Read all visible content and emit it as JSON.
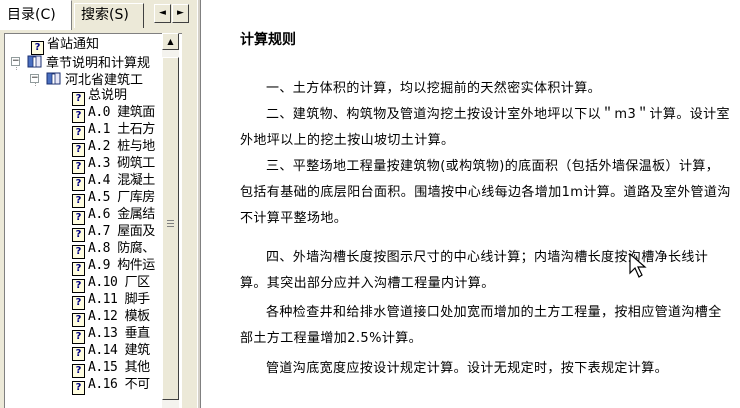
{
  "tabs": {
    "contents": "目录(C)",
    "search": "搜索(S)",
    "arrow_left": "◄",
    "arrow_right": "►"
  },
  "tree": {
    "items": [
      {
        "label": "省站通知",
        "icon": "help-page-icon"
      },
      {
        "label": "章节说明和计算规",
        "icon": "book-icon",
        "expander": "−"
      },
      {
        "label": "河北省建筑工",
        "icon": "book-icon",
        "expander": "−"
      },
      {
        "label": "总说明",
        "icon": "help-page-icon"
      },
      {
        "label": "A.0 建筑面",
        "icon": "help-page-icon"
      },
      {
        "label": "A.1 土石方",
        "icon": "help-page-icon"
      },
      {
        "label": "A.2 桩与地",
        "icon": "help-page-icon"
      },
      {
        "label": "A.3 砌筑工",
        "icon": "help-page-icon"
      },
      {
        "label": "A.4 混凝土",
        "icon": "help-page-icon"
      },
      {
        "label": "A.5 厂库房",
        "icon": "help-page-icon"
      },
      {
        "label": "A.6 金属结",
        "icon": "help-page-icon"
      },
      {
        "label": "A.7 屋面及",
        "icon": "help-page-icon"
      },
      {
        "label": "A.8 防腐、",
        "icon": "help-page-icon"
      },
      {
        "label": "A.9 构件运",
        "icon": "help-page-icon"
      },
      {
        "label": "A.10 厂区",
        "icon": "help-page-icon"
      },
      {
        "label": "A.11 脚手",
        "icon": "help-page-icon"
      },
      {
        "label": "A.12 模板",
        "icon": "help-page-icon"
      },
      {
        "label": "A.13 垂直",
        "icon": "help-page-icon"
      },
      {
        "label": "A.14 建筑",
        "icon": "help-page-icon"
      },
      {
        "label": "A.15 其他",
        "icon": "help-page-icon"
      },
      {
        "label": "A.16 不可",
        "icon": "help-page-icon"
      }
    ]
  },
  "document": {
    "title": "计算规则",
    "paragraphs": [
      "一、土方体积的计算，均以挖掘前的天然密实体积计算。",
      "二、建筑物、构筑物及管道沟挖土按设计室外地坪以下以＂m3＂计算。设计室外地坪以上的挖土按山坡切土计算。",
      "三、平整场地工程量按建筑物(或构筑物)的底面积（包括外墙保温板）计算，包括有基础的底层阳台面积。围墙按中心线每边各增加1m计算。道路及室外管道沟不计算平整场地。",
      "四、外墙沟槽长度按图示尺寸的中心线计算；内墙沟槽长度按沟槽净长线计算。其突出部分应并入沟槽工程量内计算。",
      "各种检查井和给排水管道接口处加宽而增加的土方工程量，按相应管道沟槽全部土方工程量增加2.5%计算。",
      "管道沟底宽度应按设计规定计算。设计无规定时，按下表规定计算。"
    ]
  }
}
